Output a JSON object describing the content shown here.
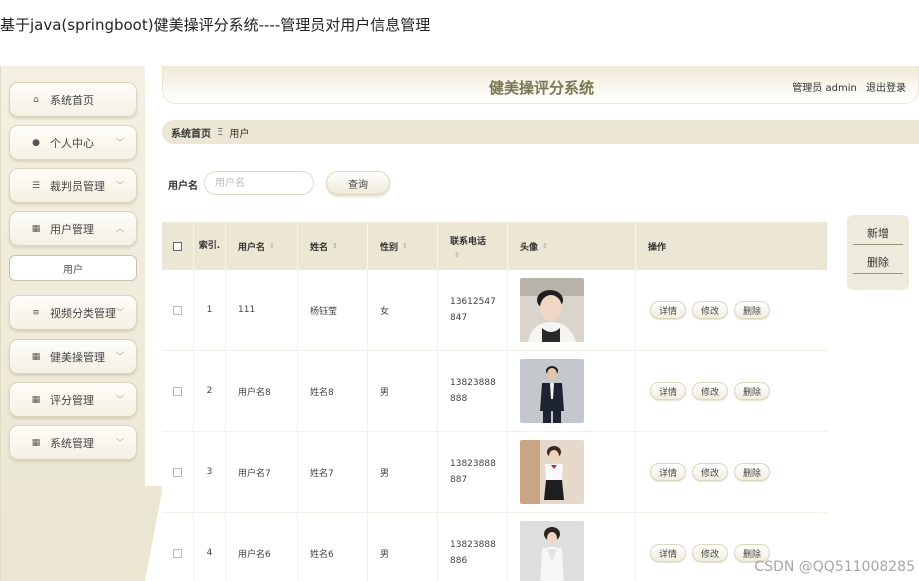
{
  "doc_title": "基于java(springboot)健美操评分系统----管理员对用户信息管理",
  "sidebar": {
    "items": [
      {
        "label": "系统首页",
        "icon": "home-icon",
        "glyph": "⌂"
      },
      {
        "label": "个人中心",
        "icon": "person-icon",
        "glyph": "●"
      },
      {
        "label": "裁判员管理",
        "icon": "sliders-icon",
        "glyph": "☰"
      },
      {
        "label": "用户管理",
        "icon": "grid-icon",
        "glyph": "▦"
      },
      {
        "label": "视频分类管理",
        "icon": "list-icon",
        "glyph": "≡"
      },
      {
        "label": "健美操管理",
        "icon": "grid-icon",
        "glyph": "▦"
      },
      {
        "label": "评分管理",
        "icon": "grid-icon",
        "glyph": "▦"
      },
      {
        "label": "系统管理",
        "icon": "grid-icon",
        "glyph": "▦"
      }
    ],
    "sub_item": "用户"
  },
  "header": {
    "title": "健美操评分系统",
    "role": "管理员 admin",
    "logout": "退出登录"
  },
  "breadcrumb": {
    "home": "系统首页",
    "separator": "Ξ",
    "current": "用户"
  },
  "search": {
    "label": "用户名",
    "placeholder": "用户名",
    "button": "查询"
  },
  "actions": {
    "add": "新增",
    "delete": "删除"
  },
  "table": {
    "headers": {
      "index": "索引.",
      "username": "用户名",
      "name": "姓名",
      "gender": "性别",
      "phone": "联系电话",
      "avatar": "头像",
      "operation": "操作"
    },
    "rows": [
      {
        "index": "1",
        "username": "111",
        "name": "杨钰莹",
        "gender": "女",
        "phone": "13612547847",
        "avatar_colors": [
          "#d8d2cb",
          "#2a2a2a"
        ]
      },
      {
        "index": "2",
        "username": "用户名8",
        "name": "姓名8",
        "gender": "男",
        "phone": "13823888888",
        "avatar_colors": [
          "#bfc3c7",
          "#1e2430"
        ]
      },
      {
        "index": "3",
        "username": "用户名7",
        "name": "姓名7",
        "gender": "男",
        "phone": "13823888887",
        "avatar_colors": [
          "#e8d6c8",
          "#8b6a4e"
        ]
      },
      {
        "index": "4",
        "username": "用户名6",
        "name": "姓名6",
        "gender": "男",
        "phone": "13823888886",
        "avatar_colors": [
          "#dcdcdc",
          "#f4f4f4"
        ]
      }
    ],
    "row_buttons": {
      "detail": "详情",
      "edit": "修改",
      "delete": "删除"
    }
  },
  "watermark": "CSDN @QQ511008285",
  "colors": {
    "accent": "#7a7552",
    "panel": "#ebe7d4",
    "sidebar": "#f3f0e3"
  }
}
